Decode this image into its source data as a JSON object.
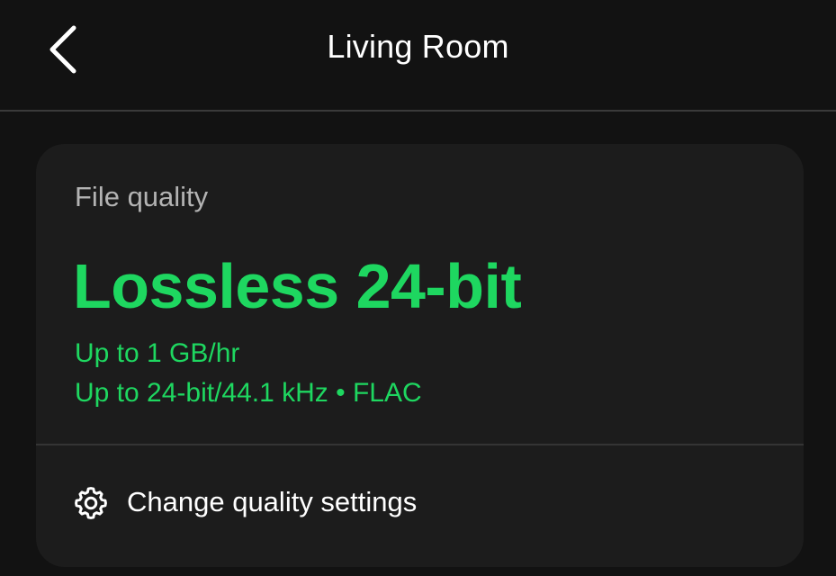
{
  "header": {
    "title": "Living Room",
    "back_icon": "chevron-left-icon"
  },
  "quality_card": {
    "label": "File quality",
    "value": "Lossless 24-bit",
    "details": [
      "Up to 1 GB/hr",
      "Up to 24-bit/44.1 kHz • FLAC"
    ],
    "settings_label": "Change quality settings",
    "settings_icon": "gear-icon"
  },
  "colors": {
    "background": "#121212",
    "card": "#1c1c1c",
    "accent": "#1ed760",
    "muted_text": "#b3b3b3",
    "text": "#ffffff"
  }
}
